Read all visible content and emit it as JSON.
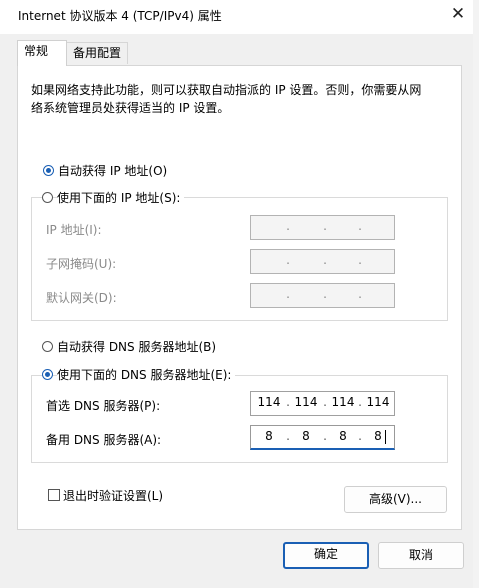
{
  "window": {
    "title": "Internet 协议版本 4 (TCP/IPv4) 属性",
    "close_glyph": "✕"
  },
  "tabs": [
    {
      "label": "常规",
      "active": true
    },
    {
      "label": "备用配置",
      "active": false
    }
  ],
  "description_line1": "如果网络支持此功能，则可以获取自动指派的 IP 设置。否则，你需要从网",
  "description_line2": "络系统管理员处获得适当的 IP 设置。",
  "ip_section": {
    "auto_label": "自动获得 IP 地址(O)",
    "manual_label": "使用下面的 IP 地址(S):",
    "fields": [
      {
        "label": "IP 地址(I):",
        "value": [
          " ",
          " ",
          " ",
          " "
        ]
      },
      {
        "label": "子网掩码(U):",
        "value": [
          " ",
          " ",
          " ",
          " "
        ]
      },
      {
        "label": "默认网关(D):",
        "value": [
          " ",
          " ",
          " ",
          " "
        ]
      }
    ]
  },
  "dns_section": {
    "auto_label": "自动获得 DNS 服务器地址(B)",
    "manual_label": "使用下面的 DNS 服务器地址(E):",
    "preferred": {
      "label": "首选 DNS 服务器(P):",
      "octets": [
        "114",
        "114",
        "114",
        "114"
      ]
    },
    "alternate": {
      "label": "备用 DNS 服务器(A):",
      "octets": [
        "8",
        "8",
        "8",
        "8"
      ]
    }
  },
  "validate_label": "退出时验证设置(L)",
  "advanced_label": "高级(V)...",
  "ok_label": "确定",
  "cancel_label": "取消",
  "accent_color": "#1a5fb4",
  "icons": {
    "close": "close-icon",
    "radio": "radio-icon",
    "checkbox": "checkbox-icon"
  }
}
